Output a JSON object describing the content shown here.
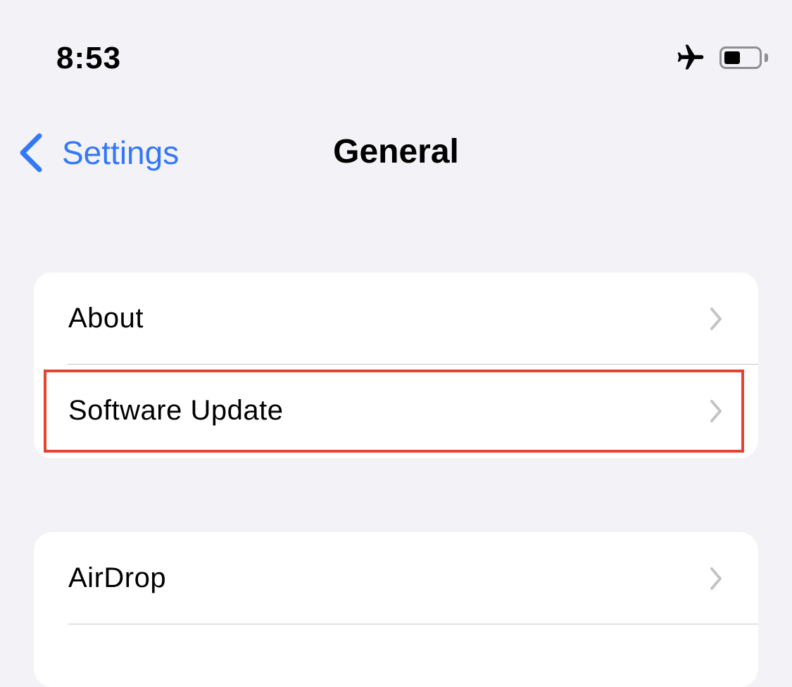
{
  "status_bar": {
    "time": "8:53",
    "icons": [
      "airplane-icon",
      "battery-icon"
    ]
  },
  "nav": {
    "back_label": "Settings",
    "title": "General",
    "accent_color": "#3478f6"
  },
  "groups": [
    {
      "items": [
        {
          "label": "About",
          "icon": "chevron-right-icon"
        },
        {
          "label": "Software Update",
          "icon": "chevron-right-icon",
          "highlighted": true
        }
      ]
    },
    {
      "items": [
        {
          "label": "AirDrop",
          "icon": "chevron-right-icon"
        }
      ]
    }
  ],
  "highlight_color": "#e34330"
}
